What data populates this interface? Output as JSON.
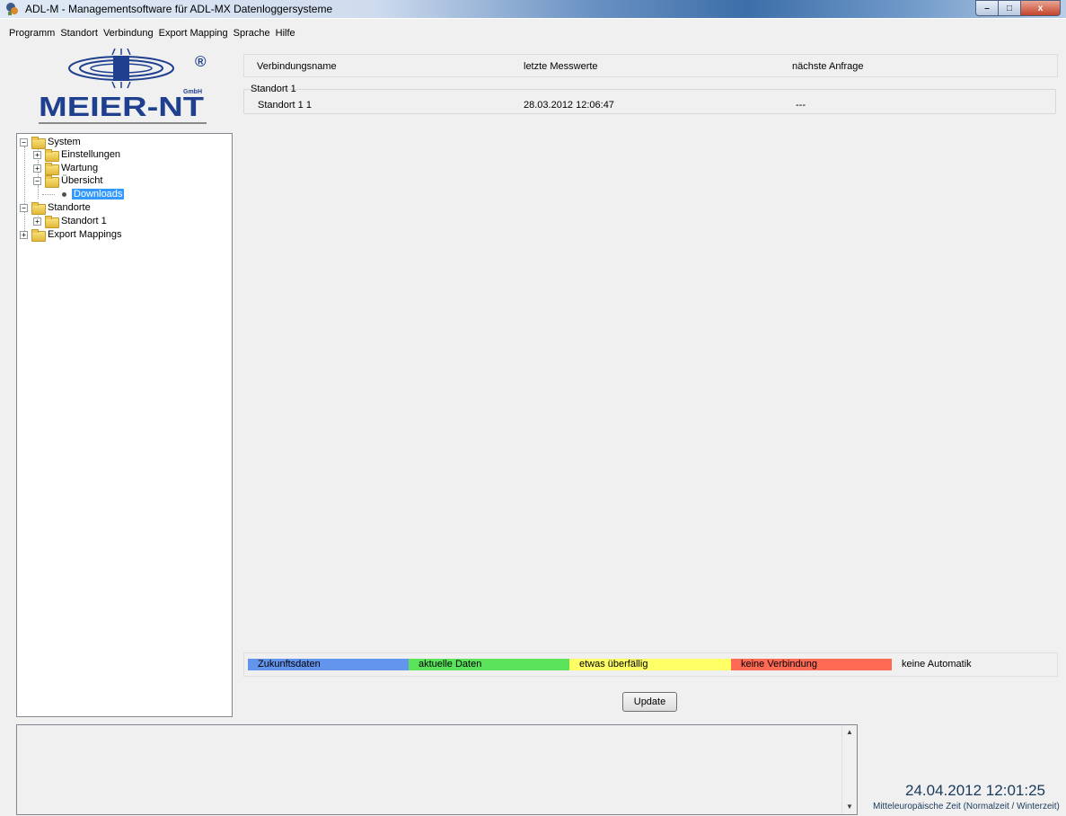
{
  "window": {
    "title": "ADL-M - Managementsoftware für ADL-MX Datenloggersysteme",
    "minimize_label": "–",
    "maximize_label": "□",
    "close_label": "x"
  },
  "menu": [
    "Programm",
    "Standort",
    "Verbindung",
    "Export Mapping",
    "Sprache",
    "Hilfe"
  ],
  "logo": {
    "brand": "MEIER-NT",
    "suffix": "GmbH",
    "registered": "®"
  },
  "tree": {
    "system": "System",
    "einstellungen": "Einstellungen",
    "wartung": "Wartung",
    "uebersicht": "Übersicht",
    "downloads": "Downloads",
    "standorte": "Standorte",
    "standort1": "Standort 1",
    "export_mappings": "Export Mappings",
    "expand_symbol": "+",
    "collapse_symbol": "−"
  },
  "table": {
    "headers": [
      "Verbindungsname",
      "letzte Messwerte",
      "nächste Anfrage"
    ],
    "group": "Standort 1",
    "rows": [
      {
        "name": "Standort 1 1",
        "last": "28.03.2012 12:06:47",
        "next": "---"
      }
    ]
  },
  "legend": [
    {
      "label": "Zukunftsdaten",
      "color": "#6495ed"
    },
    {
      "label": "aktuelle Daten",
      "color": "#5ae35a"
    },
    {
      "label": "etwas überfällig",
      "color": "#ffff66"
    },
    {
      "label": "keine Verbindung",
      "color": "#ff6a55"
    },
    {
      "label": "keine Automatik",
      "color": ""
    }
  ],
  "update_label": "Update",
  "scroll": {
    "up": "▲",
    "down": "▼"
  },
  "clock": {
    "datetime": "24.04.2012 12:01:25",
    "timezone": "Mitteleuropäische Zeit  (Normalzeit / Winterzeit)"
  }
}
